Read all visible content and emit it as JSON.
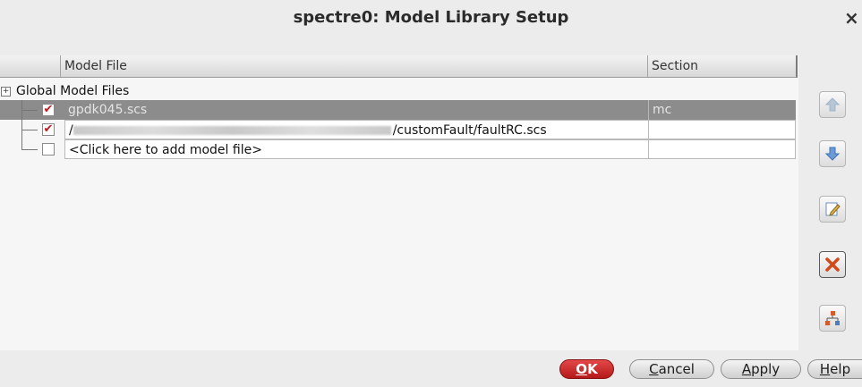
{
  "window": {
    "title": "spectre0: Model Library Setup",
    "close_glyph": "×"
  },
  "table": {
    "columns": [
      "",
      "Model File",
      "Section"
    ],
    "group_label": "Global Model Files",
    "group_expander": "+",
    "rows": [
      {
        "checked": true,
        "file": "gpdk045.scs",
        "section": "mc",
        "selected": true
      },
      {
        "checked": true,
        "file_prefix": "/",
        "file_suffix": "/customFault/faultRC.scs",
        "section": "",
        "selected": false
      },
      {
        "checked": false,
        "file": "<Click here to add model file>",
        "section": "",
        "selected": false
      }
    ],
    "check_glyph": "✔"
  },
  "side_buttons": [
    {
      "icon": "arrow-up-icon",
      "color": "#9fb4c8"
    },
    {
      "icon": "arrow-down-icon",
      "color": "#3d72b8"
    },
    {
      "icon": "edit-icon",
      "color": "#5b8fc7"
    },
    {
      "icon": "delete-icon",
      "color": "#c9451a"
    },
    {
      "icon": "tree-icon",
      "color": "#c9451a"
    }
  ],
  "buttons": {
    "ok_prefix": "",
    "ok_u": "O",
    "ok_rest": "K",
    "cancel_u": "C",
    "cancel_rest": "ancel",
    "apply_prefix": "",
    "apply_u": "A",
    "apply_rest": "pply",
    "help_u": "H",
    "help_rest": "elp"
  },
  "colors": {
    "ok": "#c62828",
    "selected_row": "#8c8c8c"
  }
}
